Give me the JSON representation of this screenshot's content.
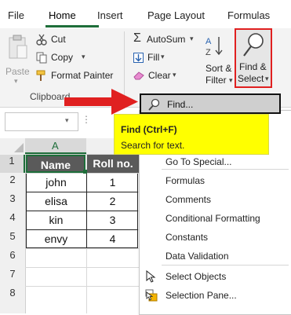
{
  "tabs": [
    {
      "label": "File"
    },
    {
      "label": "Home"
    },
    {
      "label": "Insert"
    },
    {
      "label": "Page Layout"
    },
    {
      "label": "Formulas"
    }
  ],
  "clipboard": {
    "paste_label": "Paste",
    "cut_label": "Cut",
    "copy_label": "Copy",
    "format_painter_label": "Format Painter",
    "group_label": "Clipboard"
  },
  "editing": {
    "autosum_label": "AutoSum",
    "fill_label": "Fill",
    "clear_label": "Clear",
    "sort_label_1": "Sort &",
    "sort_label_2": "Filter",
    "find_label_1": "Find &",
    "find_label_2": "Select"
  },
  "spreadsheet": {
    "column_a": "A",
    "rows": [
      "1",
      "2",
      "3",
      "4",
      "5",
      "6",
      "7",
      "8"
    ],
    "header_name": "Name",
    "header_roll": "Roll no.",
    "data": [
      {
        "name": "john",
        "roll": "1"
      },
      {
        "name": "elisa",
        "roll": "2"
      },
      {
        "name": "kin",
        "roll": "3"
      },
      {
        "name": "envy",
        "roll": "4"
      }
    ]
  },
  "menu": {
    "find_label": "Find...",
    "tooltip_title": "Find (Ctrl+F)",
    "tooltip_desc": "Search for text.",
    "items": [
      {
        "label": "Go To Special..."
      },
      {
        "label": "Formulas"
      },
      {
        "label": "Comments"
      },
      {
        "label": "Conditional Formatting"
      },
      {
        "label": "Constants"
      },
      {
        "label": "Data Validation"
      },
      {
        "label": "Select Objects"
      },
      {
        "label": "Selection Pane..."
      }
    ]
  },
  "colors": {
    "accent_green": "#1e6e3a",
    "highlight_red": "#e02020",
    "tooltip_yellow": "#ffff00",
    "header_fill": "#5a5a5a"
  }
}
